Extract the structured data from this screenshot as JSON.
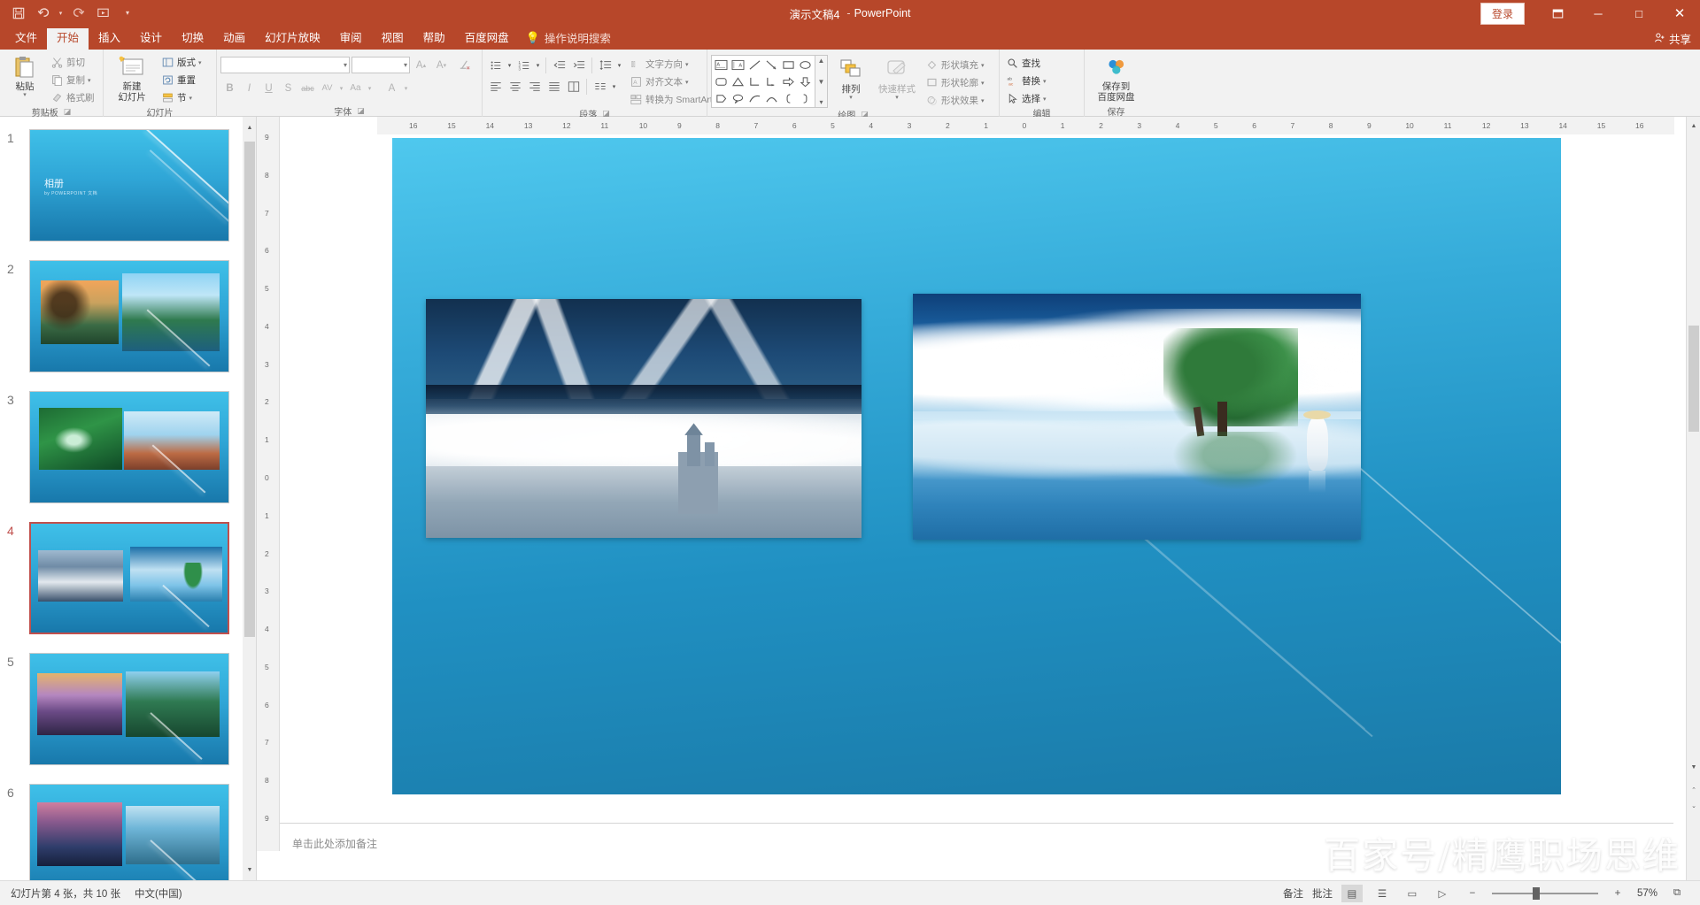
{
  "titlebar": {
    "quick_access": [
      {
        "name": "save-icon",
        "glyph": "ὋE"
      },
      {
        "name": "undo-icon",
        "glyph": "↶"
      },
      {
        "name": "redo-icon",
        "glyph": "↷"
      },
      {
        "name": "start-slideshow-icon",
        "glyph": "▶"
      },
      {
        "name": "customize-qat-icon",
        "glyph": "▾"
      }
    ],
    "file_name": "演示文稿4",
    "separator": "-",
    "app_name": "PowerPoint",
    "signin_label": "登录",
    "ribbon_display_icon": "▣",
    "minimize_icon": "─",
    "maximize_icon": "□",
    "close_icon": "✕",
    "share_label": "共享"
  },
  "tabs": [
    {
      "label": "文件",
      "active": false
    },
    {
      "label": "开始",
      "active": true
    },
    {
      "label": "插入",
      "active": false
    },
    {
      "label": "设计",
      "active": false
    },
    {
      "label": "切换",
      "active": false
    },
    {
      "label": "动画",
      "active": false
    },
    {
      "label": "幻灯片放映",
      "active": false
    },
    {
      "label": "审阅",
      "active": false
    },
    {
      "label": "视图",
      "active": false
    },
    {
      "label": "帮助",
      "active": false
    },
    {
      "label": "百度网盘",
      "active": false
    }
  ],
  "tell_me": "操作说明搜索",
  "ribbon": {
    "clipboard": {
      "label": "剪贴板",
      "paste": "粘贴",
      "cut": "剪切",
      "copy": "复制",
      "format_painter": "格式刷"
    },
    "slides": {
      "label": "幻灯片",
      "new_slide_l1": "新建",
      "new_slide_l2": "幻灯片",
      "layout": "版式",
      "reset": "重置",
      "section": "节"
    },
    "font": {
      "label": "字体",
      "font_name": "",
      "font_size": "",
      "bold": "B",
      "italic": "I",
      "underline": "U",
      "shadow": "S",
      "strikethrough": "abc",
      "char_spacing": "AV",
      "change_case": "Aa",
      "font_color": "A",
      "grow_font": "A",
      "shrink_font": "A",
      "clear_format": "✐"
    },
    "paragraph": {
      "label": "段落",
      "text_direction": "文字方向",
      "align_text": "对齐文本",
      "convert_smartart": "转换为 SmartArt"
    },
    "drawing": {
      "label": "绘图",
      "arrange": "排列",
      "quick_styles_l1": "快速样式",
      "shape_fill": "形状填充",
      "shape_outline": "形状轮廓",
      "shape_effects": "形状效果"
    },
    "editing": {
      "label": "编辑",
      "find": "查找",
      "replace": "替换",
      "select": "选择"
    },
    "save": {
      "label": "保存",
      "baidu_l1": "保存到",
      "baidu_l2": "百度网盘"
    }
  },
  "slides_panel": {
    "slides": [
      {
        "number": "1",
        "kind": "title",
        "title": "相册",
        "subtitle": "by POWERPOINT 文档",
        "selected": false
      },
      {
        "number": "2",
        "kind": "two-pic",
        "selected": false
      },
      {
        "number": "3",
        "kind": "two-pic",
        "selected": false
      },
      {
        "number": "4",
        "kind": "two-pic",
        "selected": true
      },
      {
        "number": "5",
        "kind": "two-pic",
        "selected": false
      },
      {
        "number": "6",
        "kind": "two-pic",
        "selected": false
      }
    ]
  },
  "ruler": {
    "horizontal_ticks": [
      "16",
      "15",
      "14",
      "13",
      "12",
      "11",
      "10",
      "9",
      "8",
      "7",
      "6",
      "5",
      "4",
      "3",
      "2",
      "1",
      "0",
      "1",
      "2",
      "3",
      "4",
      "5",
      "6",
      "7",
      "8",
      "9",
      "10",
      "11",
      "12",
      "13",
      "14",
      "15",
      "16"
    ],
    "vertical_ticks": [
      "9",
      "8",
      "7",
      "6",
      "5",
      "4",
      "3",
      "2",
      "1",
      "0",
      "1",
      "2",
      "3",
      "4",
      "5",
      "6",
      "7",
      "8",
      "9"
    ]
  },
  "canvas": {
    "picture_left_alt": "snow-mountains-castle-fog",
    "picture_right_alt": "clouds-tree-reflection-girl"
  },
  "notes": {
    "placeholder": "单击此处添加备注"
  },
  "statusbar": {
    "slide_info": "幻灯片第 4 张，共 10 张",
    "language": "中文(中国)",
    "notes_label": "备注",
    "comments_label": "批注",
    "zoom_level": "57%",
    "zoom_out": "−",
    "zoom_in": "+",
    "fit_icon": "⧉",
    "views": [
      {
        "name": "normal-view",
        "glyph": "▤",
        "active": true
      },
      {
        "name": "slide-sorter-view",
        "glyph": "☰",
        "active": false
      },
      {
        "name": "reading-view",
        "glyph": "▭",
        "active": false
      },
      {
        "name": "slideshow-view",
        "glyph": "▷",
        "active": false
      }
    ]
  },
  "watermark": "百家号/精鹰职场思维",
  "colors": {
    "accent": "#b7472a",
    "ribbon_bg": "#f2f2f2",
    "selected_slide_border": "#c0504d"
  }
}
